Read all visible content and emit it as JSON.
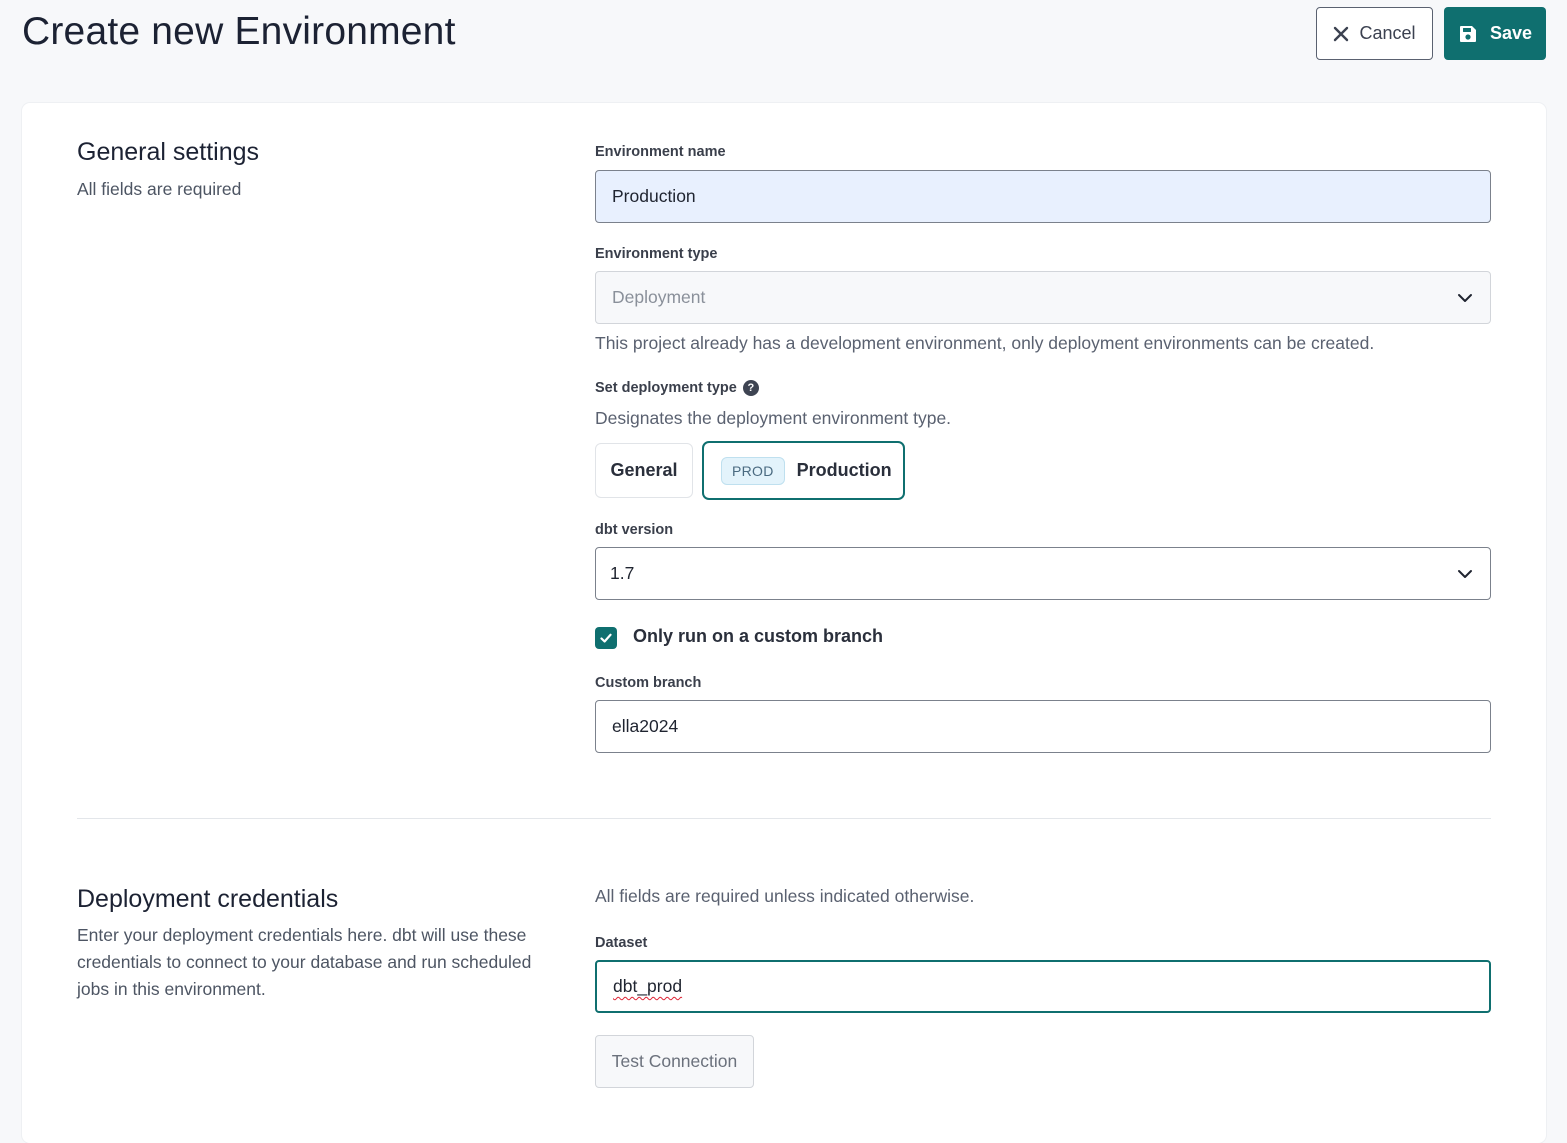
{
  "header": {
    "title": "Create new Environment",
    "cancel_label": "Cancel",
    "save_label": "Save",
    "cancel_icon": "close-icon",
    "save_icon": "floppy-disk-icon"
  },
  "general": {
    "title": "General settings",
    "subtitle": "All fields are required",
    "env_name_label": "Environment name",
    "env_name_value": "Production",
    "env_type_label": "Environment type",
    "env_type_value": "Deployment",
    "env_type_helper": "This project already has a development environment, only deployment environments can be created.",
    "deploy_type_label": "Set deployment type",
    "deploy_type_helper": "Designates the deployment environment type.",
    "deploy_options": {
      "general": "General",
      "prod_badge": "PROD",
      "production": "Production"
    },
    "selected_deploy_type": "Production",
    "dbt_version_label": "dbt version",
    "dbt_version_value": "1.7",
    "custom_branch_checkbox_label": "Only run on a custom branch",
    "custom_branch_checked": true,
    "custom_branch_label": "Custom branch",
    "custom_branch_value": "ella2024"
  },
  "credentials": {
    "title": "Deployment credentials",
    "description": "Enter your deployment credentials here. dbt will use these credentials to connect to your database and run scheduled jobs in this environment.",
    "required_note": "All fields are required unless indicated otherwise.",
    "dataset_label": "Dataset",
    "dataset_value": "dbt_prod",
    "test_button_label": "Test Connection"
  },
  "colors": {
    "accent": "#0f6f6f",
    "autofill_bg": "#e8f0fe",
    "prod_badge_bg": "#e3f3fb"
  }
}
